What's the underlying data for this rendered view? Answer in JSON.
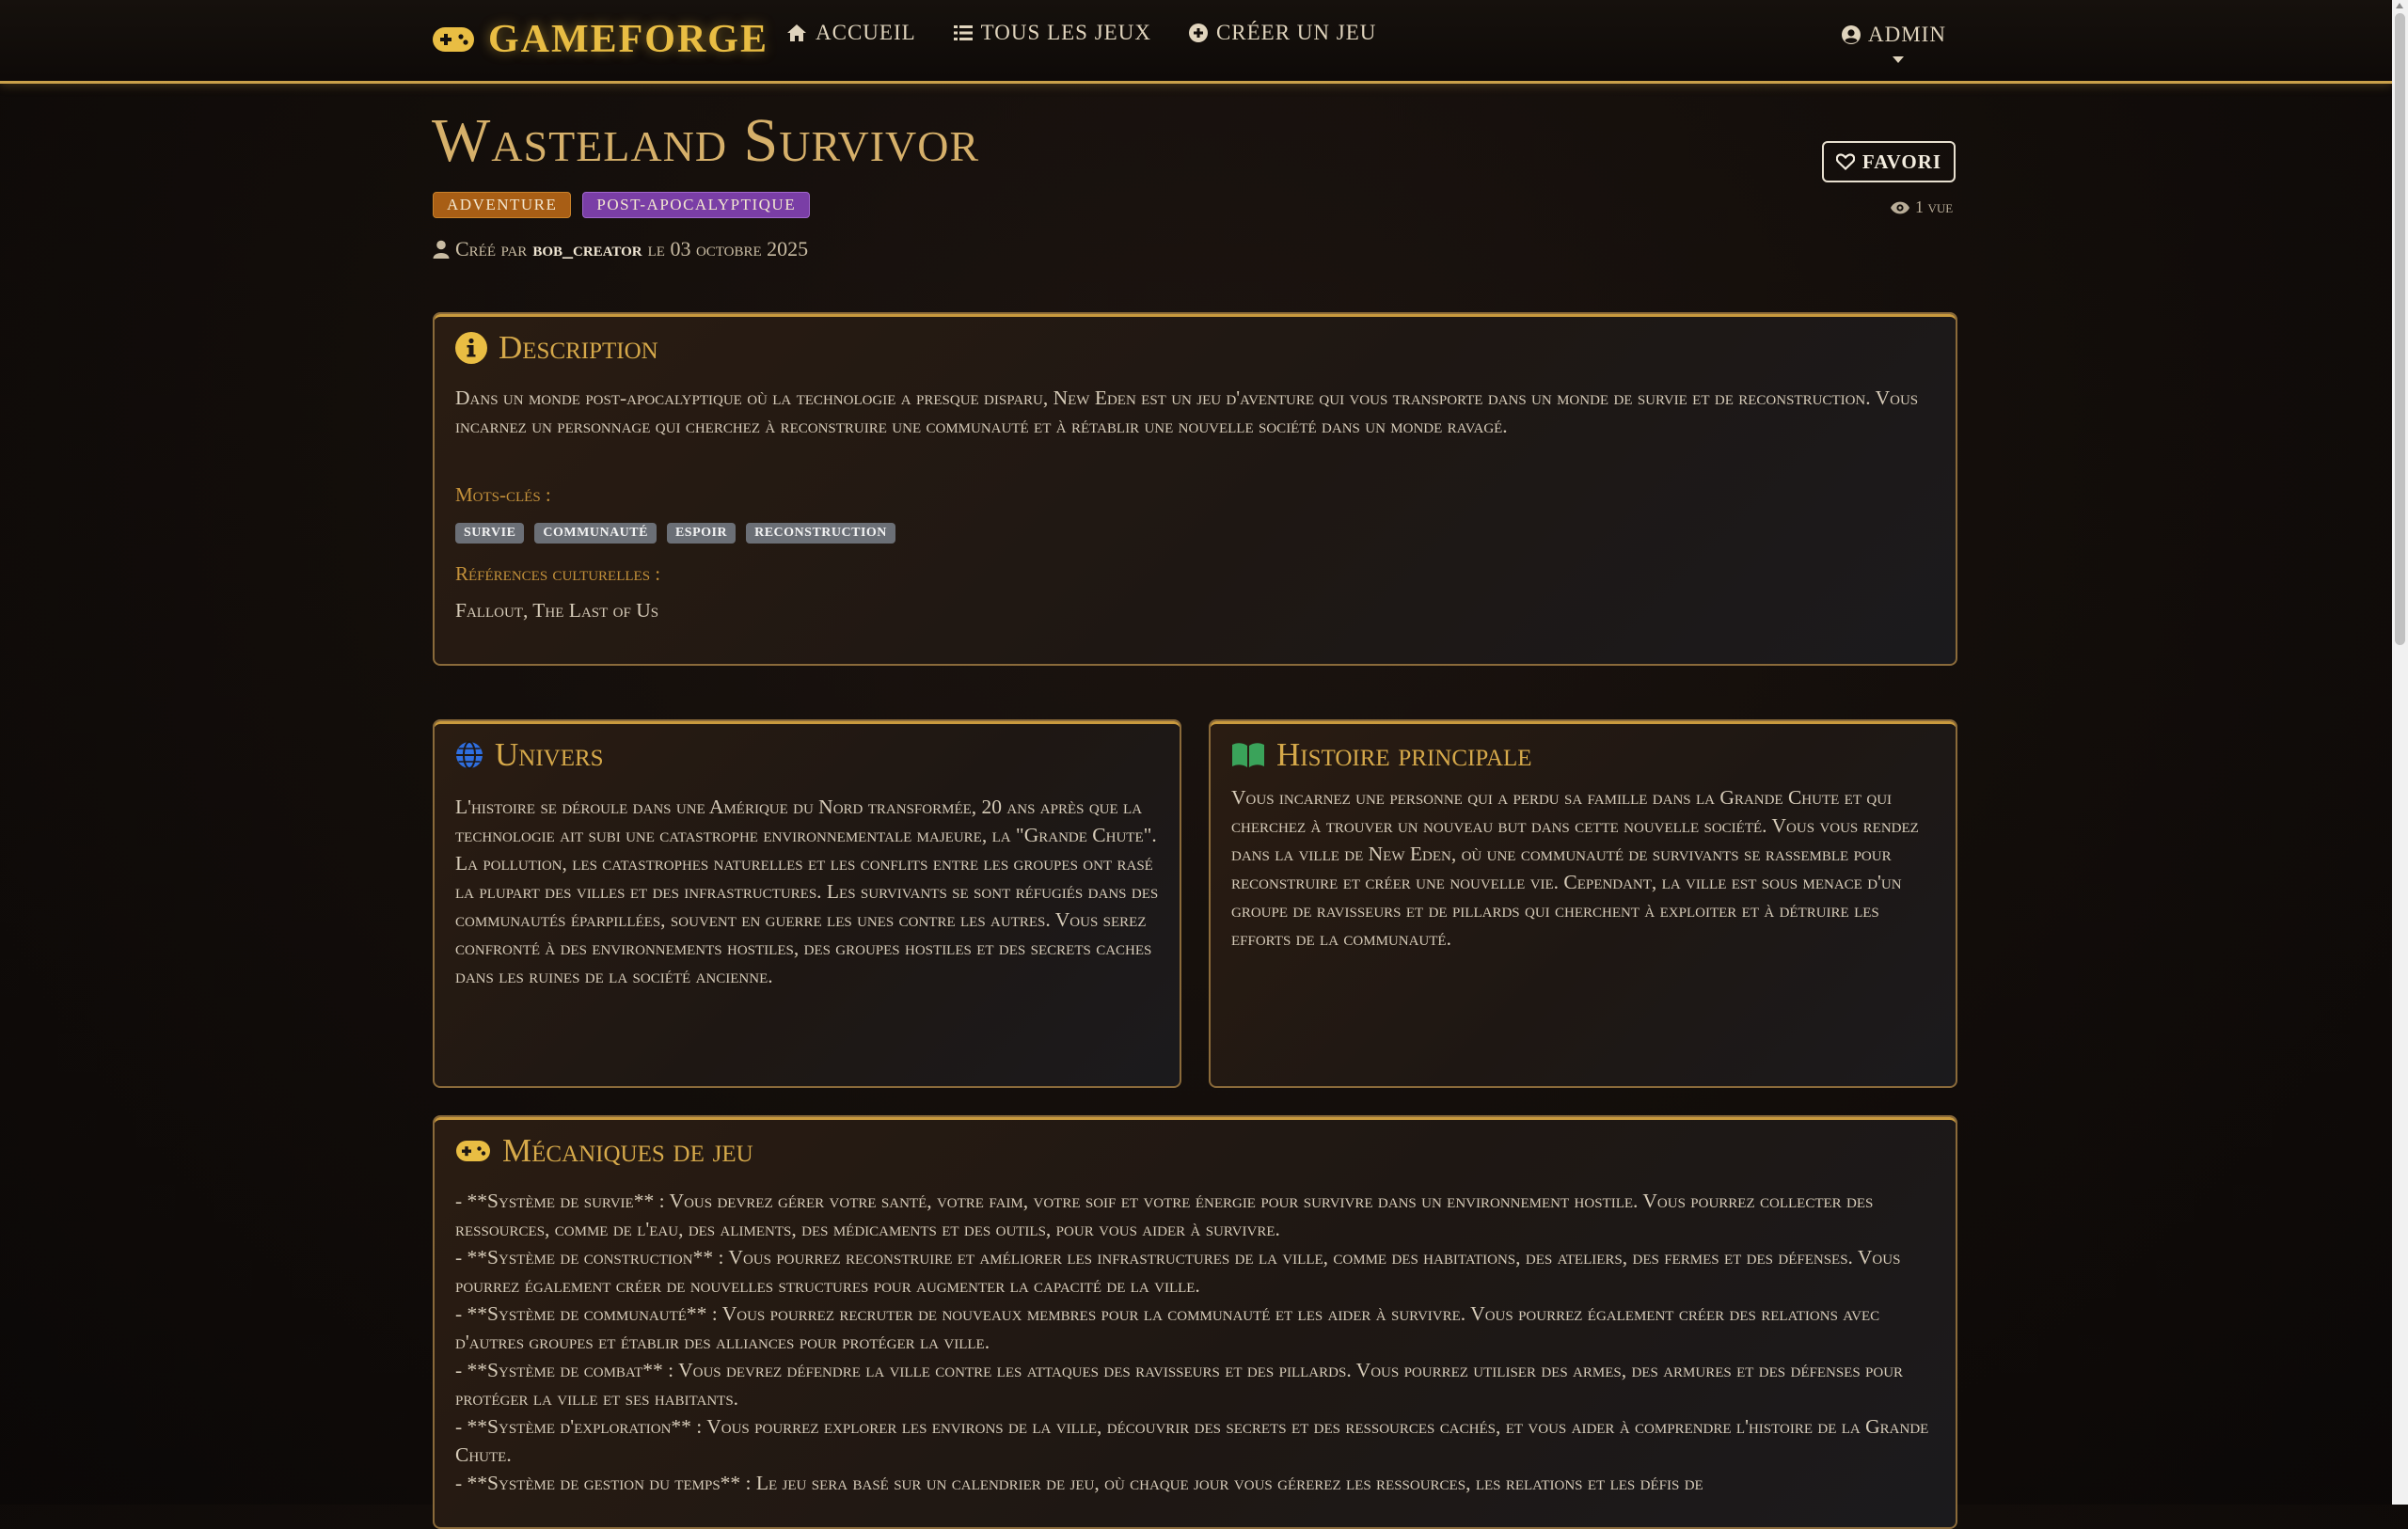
{
  "nav": {
    "brand": "GAMEFORGE",
    "links": [
      {
        "label": "ACCUEIL",
        "icon": "home-icon"
      },
      {
        "label": "TOUS LES JEUX",
        "icon": "list-icon"
      },
      {
        "label": "CRÉER UN JEU",
        "icon": "plus-circle-icon"
      }
    ],
    "user": "ADMIN"
  },
  "game": {
    "title": "Wasteland Survivor",
    "genre": "ADVENTURE",
    "theme": "POST-APOCALYPTIQUE",
    "byline_prefix": "Créé par",
    "author": "bob_creator",
    "byline_date": "le 03 octobre 2025",
    "favorite_label": "FAVORI",
    "views": "1 vue"
  },
  "description": {
    "title": "Description",
    "text": "Dans un monde post-apocalyptique où la technologie a presque disparu, New Eden est un jeu d'aventure qui vous transporte dans un monde de survie et de reconstruction. Vous incarnez un personnage qui cherchez à reconstruire une communauté et à rétablir une nouvelle société dans un monde ravagé.",
    "keywords_label": "Mots-clés :",
    "keywords": [
      "SURVIE",
      "COMMUNAUTÉ",
      "ESPOIR",
      "RECONSTRUCTION"
    ],
    "references_label": "Références culturelles :",
    "references": "Fallout, The Last of Us"
  },
  "univers": {
    "title": "Univers",
    "text": "L'histoire se déroule dans une Amérique du Nord transformée, 20 ans après que la technologie ait subi une catastrophe environnementale majeure, la \"Grande Chute\". La pollution, les catastrophes naturelles et les conflits entre les groupes ont rasé la plupart des villes et des infrastructures. Les survivants se sont réfugiés dans des communautés éparpillées, souvent en guerre les unes contre les autres. Vous serez confronté à des environnements hostiles, des groupes hostiles et des secrets caches dans les ruines de la société ancienne."
  },
  "histoire": {
    "title": "Histoire principale",
    "text": "Vous incarnez une personne qui a perdu sa famille dans la Grande Chute et qui cherchez à trouver un nouveau but dans cette nouvelle société. Vous vous rendez dans la ville de New Eden, où une communauté de survivants se rassemble pour reconstruire et créer une nouvelle vie. Cependant, la ville est sous menace d'un groupe de ravisseurs et de pillards qui cherchent à exploiter et à détruire les efforts de la communauté."
  },
  "mecaniques": {
    "title": "Mécaniques de jeu",
    "items": [
      "- **Système de survie** : Vous devrez gérer votre santé, votre faim, votre soif et votre énergie pour survivre dans un environnement hostile. Vous pourrez collecter des ressources, comme de l'eau, des aliments, des médicaments et des outils, pour vous aider à survivre.",
      "- **Système de construction** : Vous pourrez reconstruire et améliorer les infrastructures de la ville, comme des habitations, des ateliers, des fermes et des défenses. Vous pourrez également créer de nouvelles structures pour augmenter la capacité de la ville.",
      "- **Système de communauté** : Vous pourrez recruter de nouveaux membres pour la communauté et les aider à survivre. Vous pourrez également créer des relations avec d'autres groupes et établir des alliances pour protéger la ville.",
      "- **Système de combat** : Vous devrez défendre la ville contre les attaques des ravisseurs et des pillards. Vous pourrez utiliser des armes, des armures et des défenses pour protéger la ville et ses habitants.",
      "- **Système d'exploration** : Vous pourrez explorer les environs de la ville, découvrir des secrets et des ressources cachés, et vous aider à comprendre l'histoire de la Grande Chute.",
      "- **Système de gestion du temps** : Le jeu sera basé sur un calendrier de jeu, où chaque jour vous gérerez les ressources, les relations et les défis de"
    ]
  },
  "colors": {
    "accent_gold": "#c9a04a",
    "brand": "#e9bd43",
    "genre_badge": "#a85e15",
    "theme_badge": "#7a3ea6",
    "tag": "#6b6f76"
  }
}
